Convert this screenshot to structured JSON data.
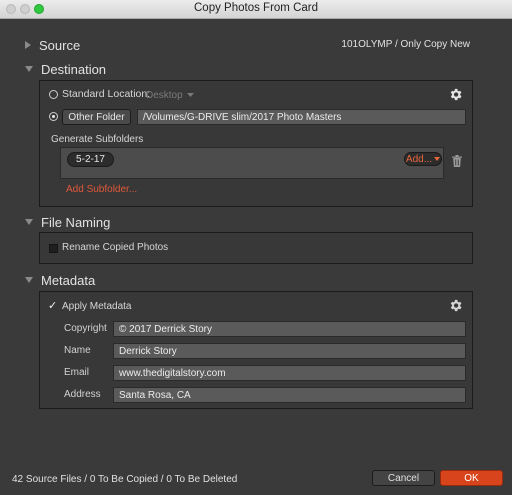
{
  "window": {
    "title": "Copy Photos From Card"
  },
  "source": {
    "title": "Source",
    "summary": "101OLYMP / Only Copy New"
  },
  "destination": {
    "title": "Destination",
    "standard_location_label": "Standard Location:",
    "standard_location_value": "Desktop",
    "other_folder_button": "Other Folder",
    "other_folder_path": "/Volumes/G-DRIVE slim/2017 Photo Masters",
    "generate_subfolders_label": "Generate Subfolders",
    "subfolder_token": "5-2-17",
    "add_token_button": "Add...",
    "add_subfolder_link": "Add Subfolder..."
  },
  "file_naming": {
    "title": "File Naming",
    "rename_label": "Rename Copied Photos",
    "rename_checked": false
  },
  "metadata": {
    "title": "Metadata",
    "apply_label": "Apply Metadata",
    "apply_checked": true,
    "checkmark": "✓",
    "fields": {
      "copyright_label": "Copyright",
      "copyright_value": "© 2017 Derrick Story",
      "name_label": "Name",
      "name_value": "Derrick Story",
      "email_label": "Email",
      "email_value": "www.thedigitalstory.com",
      "address_label": "Address",
      "address_value": "Santa Rosa, CA"
    }
  },
  "footer": {
    "status": "42 Source Files / 0 To Be Copied / 0 To Be Deleted",
    "cancel_label": "Cancel",
    "ok_label": "OK"
  },
  "colors": {
    "accent_orange": "#d8451c",
    "link_orange": "#e0583a",
    "background": "#3a3a3a"
  },
  "icons": {
    "gear": "gear-icon",
    "trash": "trash-icon",
    "chevron": "chevron-down-icon"
  }
}
